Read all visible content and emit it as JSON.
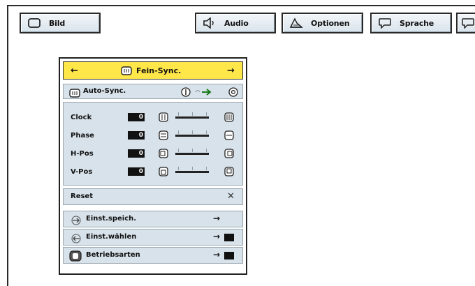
{
  "tabs": [
    {
      "label": "Bild",
      "icon": "monitor-icon"
    },
    {
      "label": "Audio",
      "icon": "speaker-icon"
    },
    {
      "label": "Optionen",
      "icon": "options-icon"
    },
    {
      "label": "Sprache",
      "icon": "speech-bubble-icon"
    }
  ],
  "menu": {
    "header": {
      "title": "Fein-Sync.",
      "left_arrow": "←",
      "right_arrow": "→"
    },
    "auto_sync": {
      "label": "Auto-Sync."
    },
    "sliders": [
      {
        "label": "Clock",
        "value": "0"
      },
      {
        "label": "Phase",
        "value": "0"
      },
      {
        "label": "H-Pos",
        "value": "0"
      },
      {
        "label": "V-Pos",
        "value": "0"
      }
    ],
    "reset": {
      "label": "Reset",
      "mark": "✕"
    },
    "actions": [
      {
        "label": "Einst.speich.",
        "arrow": "→"
      },
      {
        "label": "Einst.wählen",
        "arrow": "→"
      },
      {
        "label": "Betriebsarten",
        "arrow": "→"
      }
    ]
  },
  "colors": {
    "header_bg": "#ffe74a",
    "panel_bg": "#d7e2ea",
    "tab_bg": "#e4ecf2"
  }
}
